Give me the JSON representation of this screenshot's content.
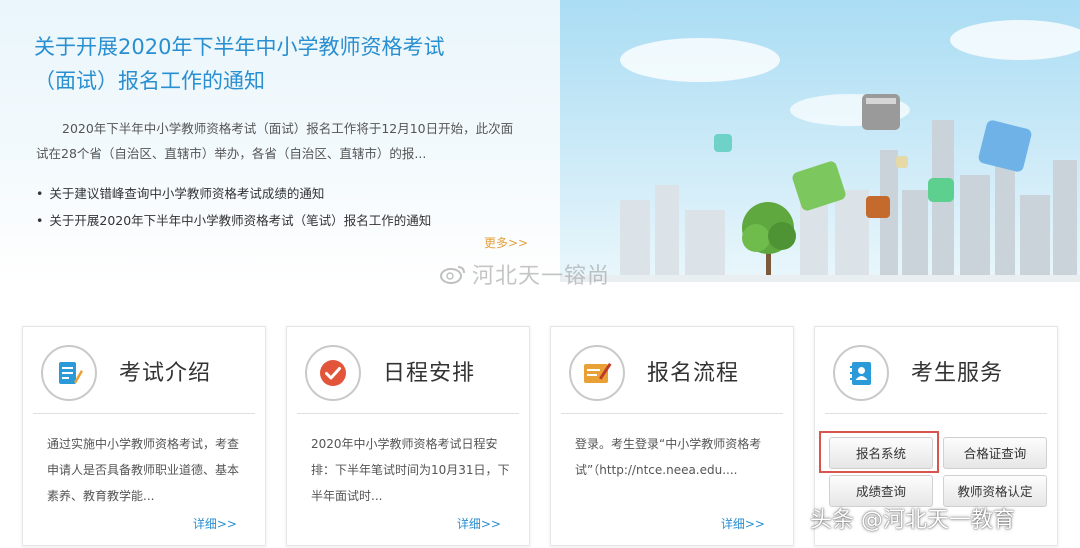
{
  "banner": {
    "title_line1": "关于开展2020年下半年中小学教师资格考试",
    "title_line2": "（面试）报名工作的通知",
    "summary": "2020年下半年中小学教师资格考试（面试）报名工作将于12月10日开始，此次面试在28个省（自治区、直辖市）举办，各省（自治区、直辖市）的报...",
    "links": [
      "关于建议错峰查询中小学教师资格考试成绩的通知",
      "关于开展2020年下半年中小学教师资格考试（笔试）报名工作的通知"
    ],
    "more_label": "更多>>"
  },
  "watermark_center": "河北天一镕尚",
  "cards": [
    {
      "title": "考试介绍",
      "icon": "document-edit-icon",
      "body": "通过实施中小学教师资格考试，考查申请人是否具备教师职业道德、基本素养、教育教学能...",
      "more": "详细>>"
    },
    {
      "title": "日程安排",
      "icon": "checkmark-icon",
      "body": "2020年中小学教师资格考试日程安排：下半年笔试时间为10月31日，下半年面试时...",
      "more": "详细>>"
    },
    {
      "title": "报名流程",
      "icon": "form-pencil-icon",
      "body": "登录。考生登录“中小学教师资格考试”（http://ntce.neea.edu....",
      "more": "详细>>"
    },
    {
      "title": "考生服务",
      "icon": "address-book-icon",
      "buttons": [
        "报名系统",
        "合格证查询",
        "成绩查询",
        "教师资格认定"
      ]
    }
  ],
  "watermark_corner": "头条 @河北天一教育",
  "colors": {
    "accent_blue": "#2a8fd0",
    "more_orange": "#e6a03c",
    "icon_red": "#e2553a",
    "icon_orange": "#e9a035",
    "icon_blue": "#2a9ad8",
    "highlight_red": "#d9534f"
  }
}
